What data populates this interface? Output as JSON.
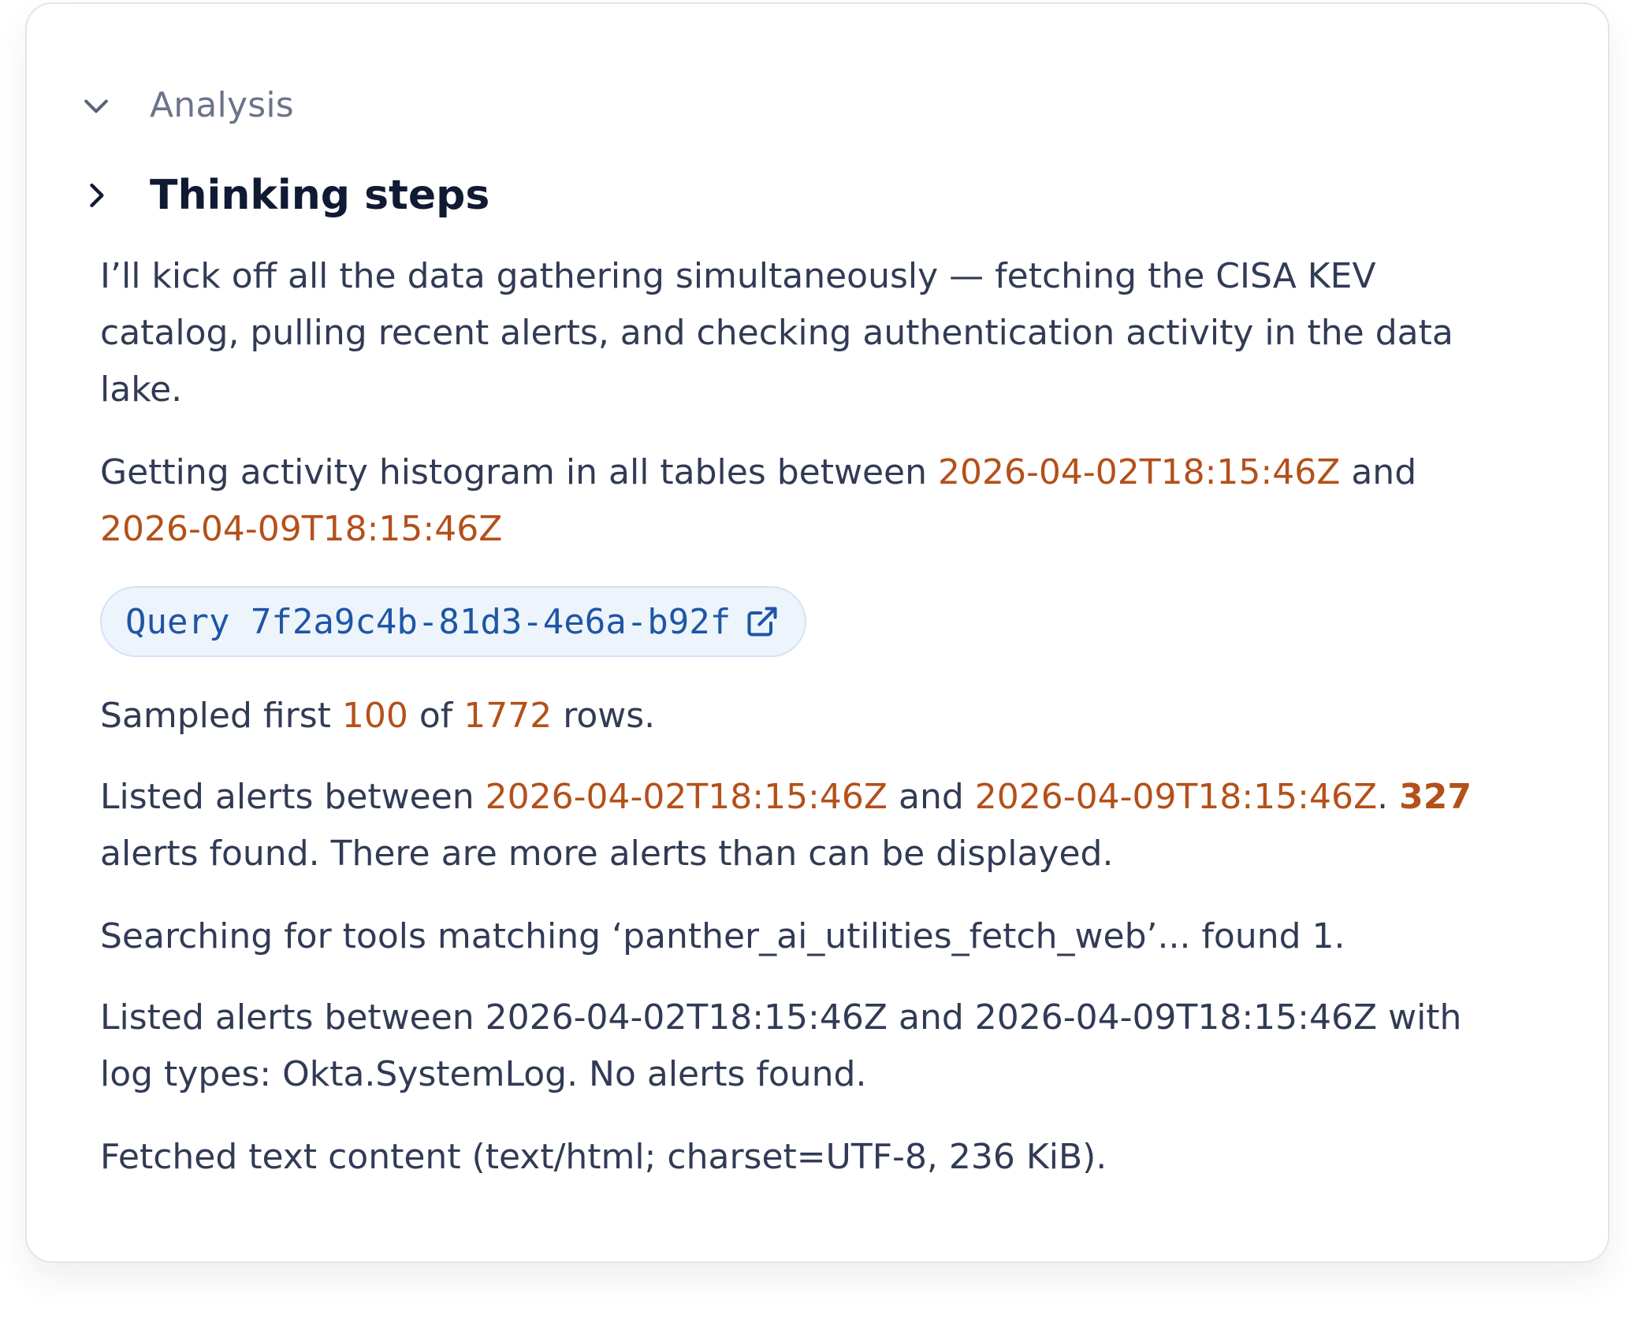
{
  "analysis": {
    "header_label": "Analysis",
    "icon": "chevron-down-icon"
  },
  "thinking": {
    "header_label": "Thinking steps",
    "icon": "chevron-right-icon"
  },
  "steps": {
    "intro": "I’ll kick off all the data gathering simultaneously — fetching the CISA KEV catalog, pulling recent alerts, and checking authentication activity in the data lake.",
    "histogram": {
      "prefix": "Getting activity histogram in all tables between ",
      "start": "2026-04-02T18:15:46Z",
      "middle": " and ",
      "end": "2026-04-09T18:15:46Z"
    },
    "query_link": {
      "label": "Query 7f2a9c4b-81d3-4e6a-b92f",
      "icon": "external-link-icon"
    },
    "sampled": {
      "prefix": "Sampled first ",
      "first": "100",
      "middle": " of ",
      "total": "1772",
      "suffix": " rows."
    },
    "alerts_listed": {
      "prefix": "Listed alerts between ",
      "start": "2026-04-02T18:15:46Z",
      "middle": " and ",
      "end": "2026-04-09T18:15:46Z",
      "sep": ". ",
      "count": "327",
      "suffix": " alerts found. There are more alerts than can be displayed."
    },
    "tool_search": "Searching for tools matching ‘panther_ai_utilities_fetch_web’... found 1.",
    "okta_alerts": "Listed alerts between 2026-04-02T18:15:46Z and 2026-04-09T18:15:46Z with log types: Okta.SystemLog. No alerts found.",
    "fetched": "Fetched text content (text/html; charset=UTF-8, 236 KiB)."
  },
  "colors": {
    "highlight": "#b4501a",
    "link": "#1e56a6",
    "text": "#313b55",
    "muted": "#6b7489"
  }
}
